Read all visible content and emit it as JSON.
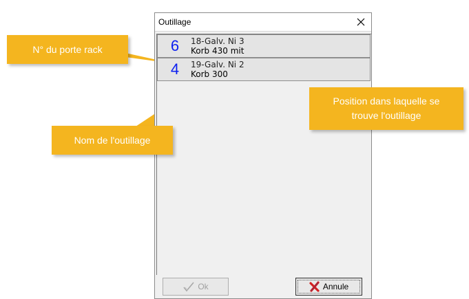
{
  "dialog": {
    "title": "Outillage",
    "close_icon": "close-icon"
  },
  "rows": [
    {
      "number": "6",
      "line1": "18-Galv. Ni 3",
      "line2": "Korb 430 mit"
    },
    {
      "number": "4",
      "line1": "19-Galv. Ni 2",
      "line2": "Korb 300"
    }
  ],
  "buttons": {
    "ok_label": "Ok",
    "ok_icon": "checkmark-icon",
    "cancel_label": "Annule",
    "cancel_icon": "red-x-icon"
  },
  "callouts": {
    "rack_number": "N° du porte rack",
    "tool_name": "Nom de l'outillage",
    "position_line1": "Position dans laquelle se",
    "position_line2": "trouve l'outillage"
  },
  "colors": {
    "callout": "#f4b51f",
    "number": "#0c1ff0",
    "cancel_x": "#d42020"
  }
}
